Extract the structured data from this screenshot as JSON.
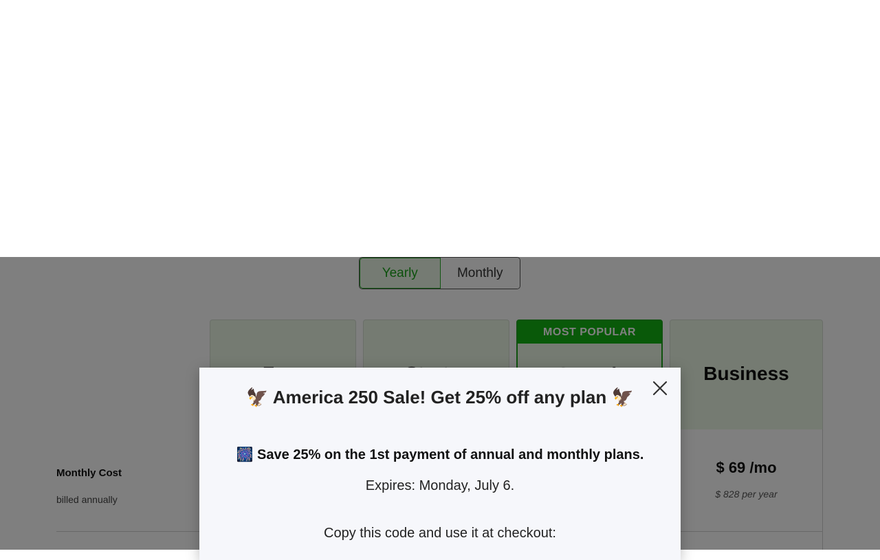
{
  "billing_toggle": {
    "yearly_label": "Yearly",
    "monthly_label": "Monthly",
    "selected": "Yearly"
  },
  "plans": [
    {
      "name": "Free"
    },
    {
      "name": "Starter"
    },
    {
      "name": "Growth",
      "badge": "MOST POPULAR"
    },
    {
      "name": "Business"
    }
  ],
  "table": {
    "monthly_cost_label": "Monthly Cost",
    "billed_label": "billed annually",
    "business_price": "$ 69 /mo",
    "business_yearly": "$ 828 per year"
  },
  "modal": {
    "title": "🦅 America 250 Sale! Get 25% off any plan 🦅",
    "headline": "🎆 Save 25% on the 1st payment of annual and monthly plans.",
    "expires": "Expires: Monday, July 6.",
    "code_label": "Copy this code and use it at checkout:",
    "close_icon": "close-icon"
  },
  "colors": {
    "accent_green": "#12b312",
    "plan_header_bg": "#eaf6e4",
    "overlay": "rgba(0,0,0,0.5)"
  }
}
